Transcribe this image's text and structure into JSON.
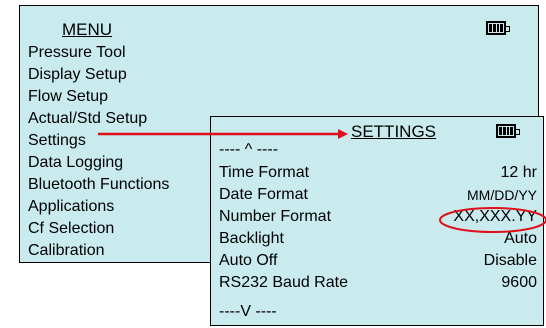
{
  "main": {
    "title": "MENU",
    "items": [
      "Pressure Tool",
      "Display Setup",
      "Flow Setup",
      "Actual/Std Setup",
      "Settings",
      "Data Logging",
      "Bluetooth Functions",
      "Applications",
      "Cf Selection",
      "Calibration"
    ]
  },
  "settings": {
    "title": "SETTINGS",
    "scroll_up": "---- ^ ----",
    "scroll_down": "----V ----",
    "rows": [
      {
        "label": "Time Format",
        "value": "12 hr"
      },
      {
        "label": "Date Format",
        "value": "MM/DD/YY"
      },
      {
        "label": "Number Format",
        "value": "XX,XXX.YY"
      },
      {
        "label": "Backlight",
        "value": "Auto"
      },
      {
        "label": "Auto Off",
        "value": "Disable"
      },
      {
        "label": "RS232 Baud Rate",
        "value": "9600"
      }
    ]
  },
  "colors": {
    "screen_bg": "#c9ebee",
    "annotation": "#e0101a"
  },
  "icons": [
    "battery-icon",
    "red-arrow",
    "red-ellipse"
  ]
}
